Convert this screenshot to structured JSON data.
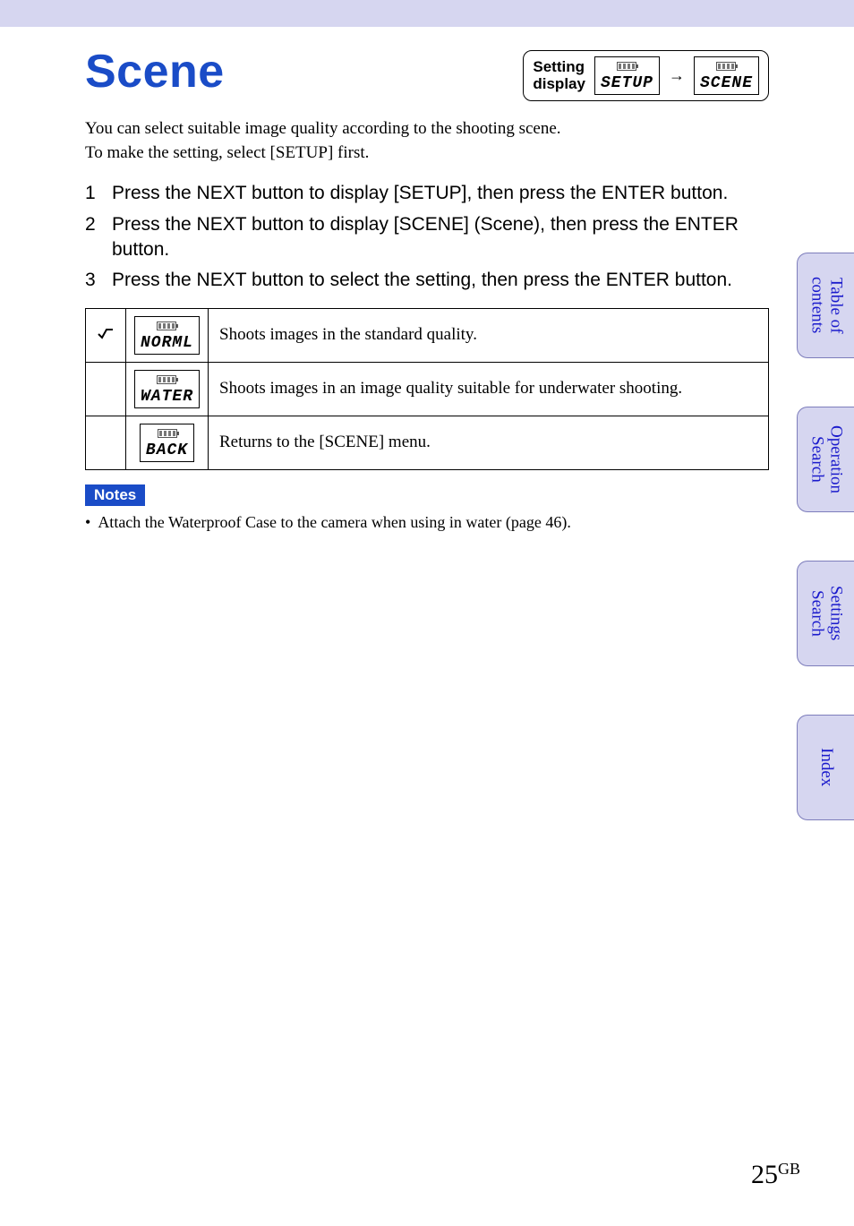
{
  "title": "Scene",
  "setting_display": {
    "label": "Setting\ndisplay",
    "step1": "SETUP",
    "step2": "SCENE"
  },
  "intro_line1": "You can select suitable image quality according to the shooting scene.",
  "intro_line2": "To make the setting, select [SETUP] first.",
  "steps": [
    {
      "n": "1",
      "text": "Press the NEXT button to display [SETUP], then press the ENTER button."
    },
    {
      "n": "2",
      "text": "Press the NEXT button to display [SCENE] (Scene), then press the ENTER button."
    },
    {
      "n": "3",
      "text": "Press the NEXT button to select the setting, then press the ENTER button."
    }
  ],
  "options": [
    {
      "checked": true,
      "code": "NORML",
      "desc": "Shoots images in the standard quality."
    },
    {
      "checked": false,
      "code": "WATER",
      "desc": "Shoots images in an image quality suitable for underwater shooting."
    },
    {
      "checked": false,
      "code": "BACK",
      "desc": "Returns to the [SCENE] menu."
    }
  ],
  "notes_label": "Notes",
  "notes": [
    "Attach the Waterproof Case to the camera when using in water (page 46)."
  ],
  "tabs": [
    "Table of\ncontents",
    "Operation\nSearch",
    "Settings\nSearch",
    "Index"
  ],
  "page": {
    "num": "25",
    "suffix": "GB"
  }
}
